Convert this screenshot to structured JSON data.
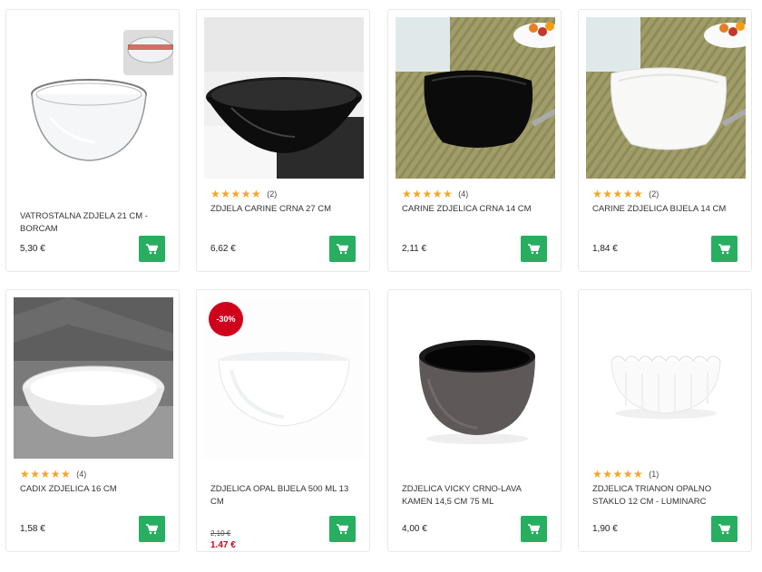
{
  "products": [
    {
      "name": "VATROSTALNA ZDJELA 21 CM - BORCAM",
      "price": "5,30 €",
      "image": "glass-bowl"
    },
    {
      "name": "ZDJELA CARINE CRNA 27 CM",
      "rating": "★★★★★",
      "count": "(2)",
      "price": "6,62 €",
      "image": "black-bowl-large"
    },
    {
      "name": "CARINE ZDJELICA CRNA 14 CM",
      "rating": "★★★★★",
      "count": "(4)",
      "price": "2,11 €",
      "image": "black-bowl-table"
    },
    {
      "name": "CARINE ZDJELICA BIJELA 14 CM",
      "rating": "★★★★★",
      "count": "(2)",
      "price": "1,84 €",
      "image": "white-bowl-table"
    },
    {
      "name": "CADIX ZDJELICA 16 CM",
      "rating": "★★★★★",
      "count": "(4)",
      "price": "1,58 €",
      "image": "white-bowl-concrete"
    },
    {
      "name": "ZDJELICA OPAL BIJELA 500 mL 13 cm",
      "old_price": "2,10 €",
      "sale_price": "1.47 €",
      "badge": "-30%",
      "image": "white-opal-bowl"
    },
    {
      "name": "ZDJELICA VICKY CRNO-LAVA KAMEN 14,5 cm 75 mL",
      "price": "4,00 €",
      "image": "black-lava-bowl"
    },
    {
      "name": "ZDJELICA TRIANON OPALNO STAKLO 12 cm - LUMINARC",
      "rating": "★★★★★",
      "count": "(1)",
      "price": "1,90 €",
      "image": "scalloped-white-bowl"
    }
  ],
  "colors": {
    "cart_button": "#27ae60",
    "stars": "#f5a623",
    "sale": "#d0021b"
  },
  "icons": {
    "cart": "shopping-cart-icon",
    "rating": "star-icon"
  }
}
